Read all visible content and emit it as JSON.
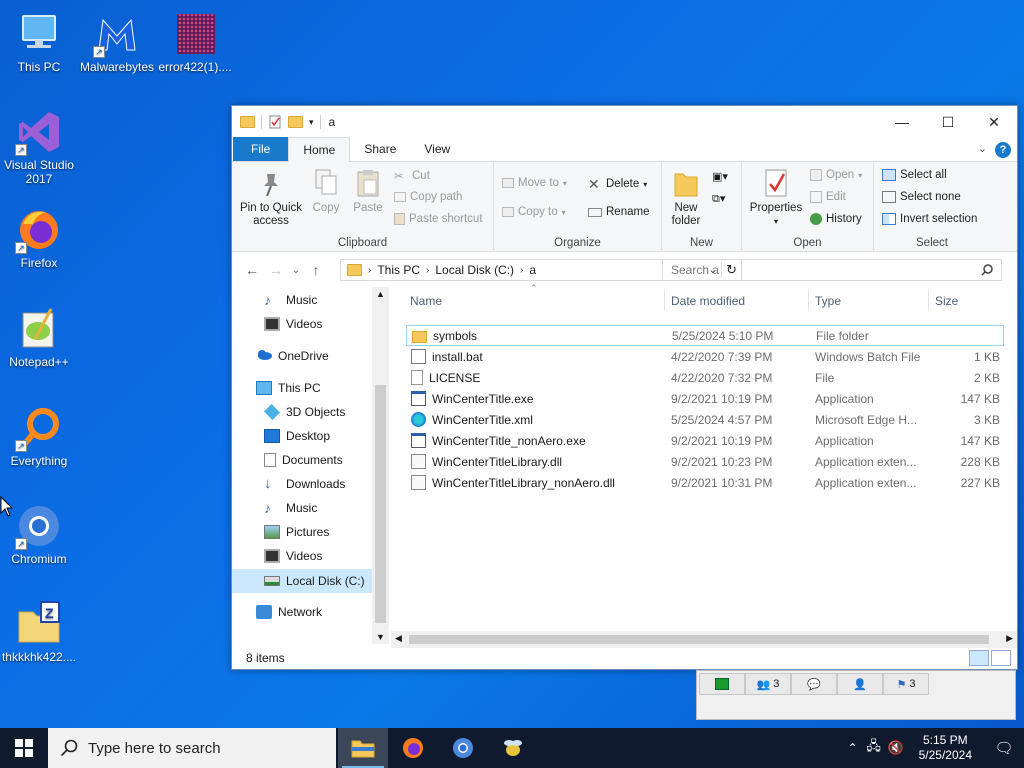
{
  "desktop": {
    "icons": [
      {
        "name": "This PC"
      },
      {
        "name": "Malwarebytes"
      },
      {
        "name": "error422(1)...."
      },
      {
        "name": "Visual Studio 2017"
      },
      {
        "name": "Firefox"
      },
      {
        "name": "Notepad++"
      },
      {
        "name": "Everything"
      },
      {
        "name": "Chromium"
      },
      {
        "name": "thkkkhk422...."
      }
    ]
  },
  "explorer": {
    "title": "a",
    "tabs": {
      "file": "File",
      "home": "Home",
      "share": "Share",
      "view": "View"
    },
    "ribbon": {
      "clipboard": {
        "name": "Clipboard",
        "pin": "Pin to Quick access",
        "copy": "Copy",
        "paste": "Paste",
        "cut": "Cut",
        "copy_path": "Copy path",
        "paste_shortcut": "Paste shortcut"
      },
      "organize": {
        "name": "Organize",
        "move_to": "Move to",
        "copy_to": "Copy to",
        "delete": "Delete",
        "rename": "Rename"
      },
      "new": {
        "name": "New",
        "new_folder": "New folder"
      },
      "open": {
        "name": "Open",
        "properties": "Properties",
        "open": "Open",
        "edit": "Edit",
        "history": "History"
      },
      "select": {
        "name": "Select",
        "select_all": "Select all",
        "select_none": "Select none",
        "invert": "Invert selection"
      }
    },
    "address": {
      "crumbs": [
        "This PC",
        "Local Disk (C:)",
        "a"
      ]
    },
    "search": {
      "placeholder": "Search a"
    },
    "nav": [
      {
        "label": "Music",
        "icon": "music-icon"
      },
      {
        "label": "Videos",
        "icon": "videos-icon"
      },
      {
        "label": "OneDrive",
        "icon": "onedrive-icon"
      },
      {
        "label": "This PC",
        "icon": "this-pc-icon"
      },
      {
        "label": "3D Objects",
        "icon": "3d-objects-icon"
      },
      {
        "label": "Desktop",
        "icon": "desktop-folder-icon"
      },
      {
        "label": "Documents",
        "icon": "documents-icon"
      },
      {
        "label": "Downloads",
        "icon": "downloads-icon"
      },
      {
        "label": "Music",
        "icon": "music-icon"
      },
      {
        "label": "Pictures",
        "icon": "pictures-icon"
      },
      {
        "label": "Videos",
        "icon": "videos-icon"
      },
      {
        "label": "Local Disk (C:)",
        "icon": "drive-icon"
      },
      {
        "label": "Network",
        "icon": "network-icon"
      }
    ],
    "columns": {
      "name": "Name",
      "date": "Date modified",
      "type": "Type",
      "size": "Size"
    },
    "files": [
      {
        "name": "symbols",
        "date": "5/25/2024 5:10 PM",
        "type": "File folder",
        "size": "",
        "icon": "folder-icon"
      },
      {
        "name": "install.bat",
        "date": "4/22/2020 7:39 PM",
        "type": "Windows Batch File",
        "size": "1 KB",
        "icon": "batch-file-icon"
      },
      {
        "name": "LICENSE",
        "date": "4/22/2020 7:32 PM",
        "type": "File",
        "size": "2 KB",
        "icon": "file-icon"
      },
      {
        "name": "WinCenterTitle.exe",
        "date": "9/2/2021 10:19 PM",
        "type": "Application",
        "size": "147 KB",
        "icon": "exe-icon"
      },
      {
        "name": "WinCenterTitle.xml",
        "date": "5/25/2024 4:57 PM",
        "type": "Microsoft Edge H...",
        "size": "3 KB",
        "icon": "edge-icon"
      },
      {
        "name": "WinCenterTitle_nonAero.exe",
        "date": "9/2/2021 10:19 PM",
        "type": "Application",
        "size": "147 KB",
        "icon": "exe-icon"
      },
      {
        "name": "WinCenterTitleLibrary.dll",
        "date": "9/2/2021 10:23 PM",
        "type": "Application exten...",
        "size": "228 KB",
        "icon": "dll-icon"
      },
      {
        "name": "WinCenterTitleLibrary_nonAero.dll",
        "date": "9/2/2021 10:31 PM",
        "type": "Application exten...",
        "size": "227 KB",
        "icon": "dll-icon"
      }
    ],
    "status": "8 items"
  },
  "tray_popup": {
    "badges": [
      "3",
      "3"
    ]
  },
  "taskbar": {
    "search_placeholder": "Type here to search",
    "time": "5:15 PM",
    "date": "5/25/2024"
  }
}
